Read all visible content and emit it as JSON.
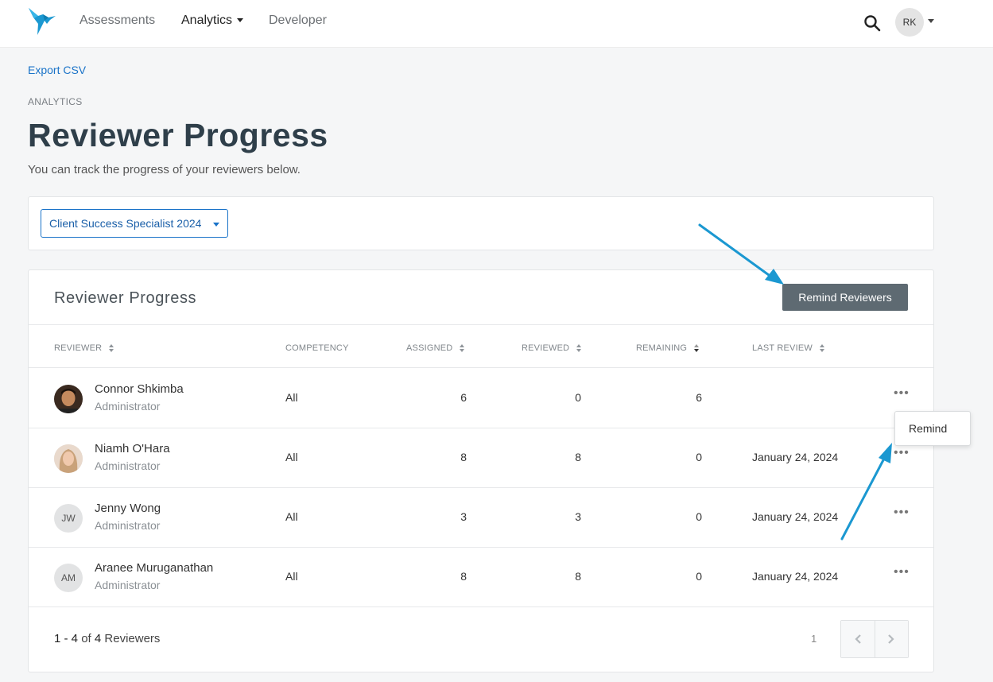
{
  "nav": {
    "items": [
      "Assessments",
      "Analytics",
      "Developer"
    ],
    "user_initials": "RK"
  },
  "page": {
    "export_label": "Export CSV",
    "eyebrow": "ANALYTICS",
    "title": "Reviewer Progress",
    "subtitle": "You can track the progress of your reviewers below."
  },
  "filter": {
    "selected": "Client Success Specialist 2024"
  },
  "table": {
    "title": "Reviewer Progress",
    "remind_all_label": "Remind Reviewers",
    "columns": [
      "REVIEWER",
      "COMPETENCY",
      "ASSIGNED",
      "REVIEWED",
      "REMAINING",
      "LAST REVIEW"
    ],
    "rows": [
      {
        "name": "Connor Shkimba",
        "role": "Administrator",
        "initials": "",
        "competency": "All",
        "assigned": "6",
        "reviewed": "0",
        "remaining": "6",
        "last_review": ""
      },
      {
        "name": "Niamh O'Hara",
        "role": "Administrator",
        "initials": "",
        "competency": "All",
        "assigned": "8",
        "reviewed": "8",
        "remaining": "0",
        "last_review": "January 24, 2024"
      },
      {
        "name": "Jenny Wong",
        "role": "Administrator",
        "initials": "JW",
        "competency": "All",
        "assigned": "3",
        "reviewed": "3",
        "remaining": "0",
        "last_review": "January 24, 2024"
      },
      {
        "name": "Aranee Muruganathan",
        "role": "Administrator",
        "initials": "AM",
        "competency": "All",
        "assigned": "8",
        "reviewed": "8",
        "remaining": "0",
        "last_review": "January 24, 2024"
      }
    ],
    "row_menu_glyph": "•••",
    "footer": {
      "range": "1 - 4",
      "of": "of",
      "total": "4",
      "noun": "Reviewers",
      "page": "1"
    },
    "popover_label": "Remind"
  },
  "colors": {
    "accent": "#1a73c8",
    "button": "#5e6a72",
    "annotation": "#1b98d1"
  }
}
